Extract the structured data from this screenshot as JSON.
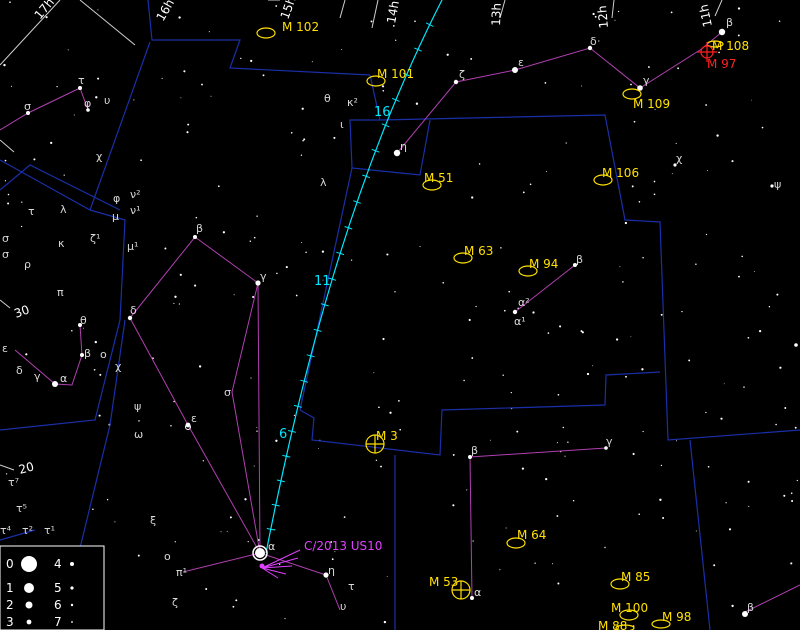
{
  "colors": {
    "background": "#000000",
    "constellation_boundary": "#1a2fa8",
    "constellation_line": "#b040b0",
    "grid": "#cfcfcf",
    "star": "#ffffff",
    "dso": "#ffe000",
    "dso_highlight": "#ff2020",
    "comet_track": "#00e8ff",
    "comet": "#e040ff"
  },
  "ra_labels": [
    "17h",
    "16h",
    "15h",
    "14h",
    "13h",
    "12h",
    "11h"
  ],
  "dec_labels": [
    "30",
    "20"
  ],
  "comet": {
    "name": "C/2013 US10",
    "track_labels": [
      "16",
      "11",
      "6"
    ]
  },
  "dsos": [
    {
      "id": "m102",
      "label": "M 102",
      "kind": "galaxy"
    },
    {
      "id": "m101",
      "label": "M 101",
      "kind": "galaxy"
    },
    {
      "id": "m51",
      "label": "M 51",
      "kind": "galaxy"
    },
    {
      "id": "m106",
      "label": "M 106",
      "kind": "galaxy"
    },
    {
      "id": "m63",
      "label": "M 63",
      "kind": "galaxy"
    },
    {
      "id": "m94",
      "label": "M 94",
      "kind": "galaxy"
    },
    {
      "id": "m108",
      "label": "M 108",
      "kind": "galaxy"
    },
    {
      "id": "m97",
      "label": "M 97",
      "kind": "planetary",
      "highlight": true
    },
    {
      "id": "m109",
      "label": "M 109",
      "kind": "galaxy"
    },
    {
      "id": "m3",
      "label": "M 3",
      "kind": "cluster"
    },
    {
      "id": "m64",
      "label": "M 64",
      "kind": "galaxy"
    },
    {
      "id": "m53",
      "label": "M 53",
      "kind": "cluster"
    },
    {
      "id": "m85",
      "label": "M 85",
      "kind": "galaxy"
    },
    {
      "id": "m100",
      "label": "M 100",
      "kind": "galaxy"
    },
    {
      "id": "m98",
      "label": "M 98",
      "kind": "galaxy"
    },
    {
      "id": "m88",
      "label": "M 88",
      "kind": "galaxy"
    }
  ],
  "star_labels": {
    "tau_her": "τ",
    "sigma_her": "σ",
    "phi_her": "φ",
    "upsilon_her": "υ",
    "chi_her": "χ",
    "theta_dra": "θ",
    "kappa2": "κ²",
    "iota": "ι",
    "eta_uma": "η",
    "zeta_uma": "ζ",
    "eps_uma": "ε",
    "delta_uma": "δ",
    "gamma_uma": "γ",
    "beta_uma": "β",
    "lambda_boo": "λ",
    "chi_uma": "χ",
    "psi_uma": "ψ",
    "phi_boo": "φ",
    "nu2": "ν²",
    "nu1": "ν¹",
    "mu": "μ",
    "mu1": "μ¹",
    "tau_cb": "τ",
    "lambda_cb": "λ",
    "sigma_cb": "σ",
    "kappa_cb": "κ",
    "zeta1": "ζ¹",
    "rho": "ρ",
    "pi_cb": "π",
    "theta_cb": "θ",
    "beta_cb": "β",
    "omicron": "ο",
    "epsilon_cb": "ε",
    "delta_cb": "δ",
    "gamma_cb": "γ",
    "alpha_cb": "α",
    "chi_cb": "χ",
    "beta_boo": "β",
    "gamma_boo": "γ",
    "delta_boo": "δ",
    "sigma_boo": "σ",
    "epsilon_boo": "ε",
    "psi_boo": "ψ",
    "omega_boo": "ω",
    "xi_boo": "ξ",
    "omicron_boo": "ο",
    "pi1_boo": "π¹",
    "zeta_boo": "ζ",
    "alpha_boo": "α",
    "eta_boo": "η",
    "tau_boo": "τ",
    "upsilon_boo": "υ",
    "beta_cvn": "β",
    "alpha2_cvn": "α²",
    "alpha1_cvn": "α¹",
    "beta_com": "β",
    "gamma_com": "γ",
    "alpha_com": "α",
    "beta_leo": "β",
    "tau7": "τ⁷",
    "tau5": "τ⁵",
    "tau4": "τ⁴",
    "tau2": "τ²",
    "tau1": "τ¹"
  },
  "legend": {
    "items": [
      {
        "mag": "0"
      },
      {
        "mag": "1"
      },
      {
        "mag": "2"
      },
      {
        "mag": "3"
      },
      {
        "mag": "4"
      },
      {
        "mag": "5"
      },
      {
        "mag": "6"
      },
      {
        "mag": "7"
      }
    ]
  }
}
